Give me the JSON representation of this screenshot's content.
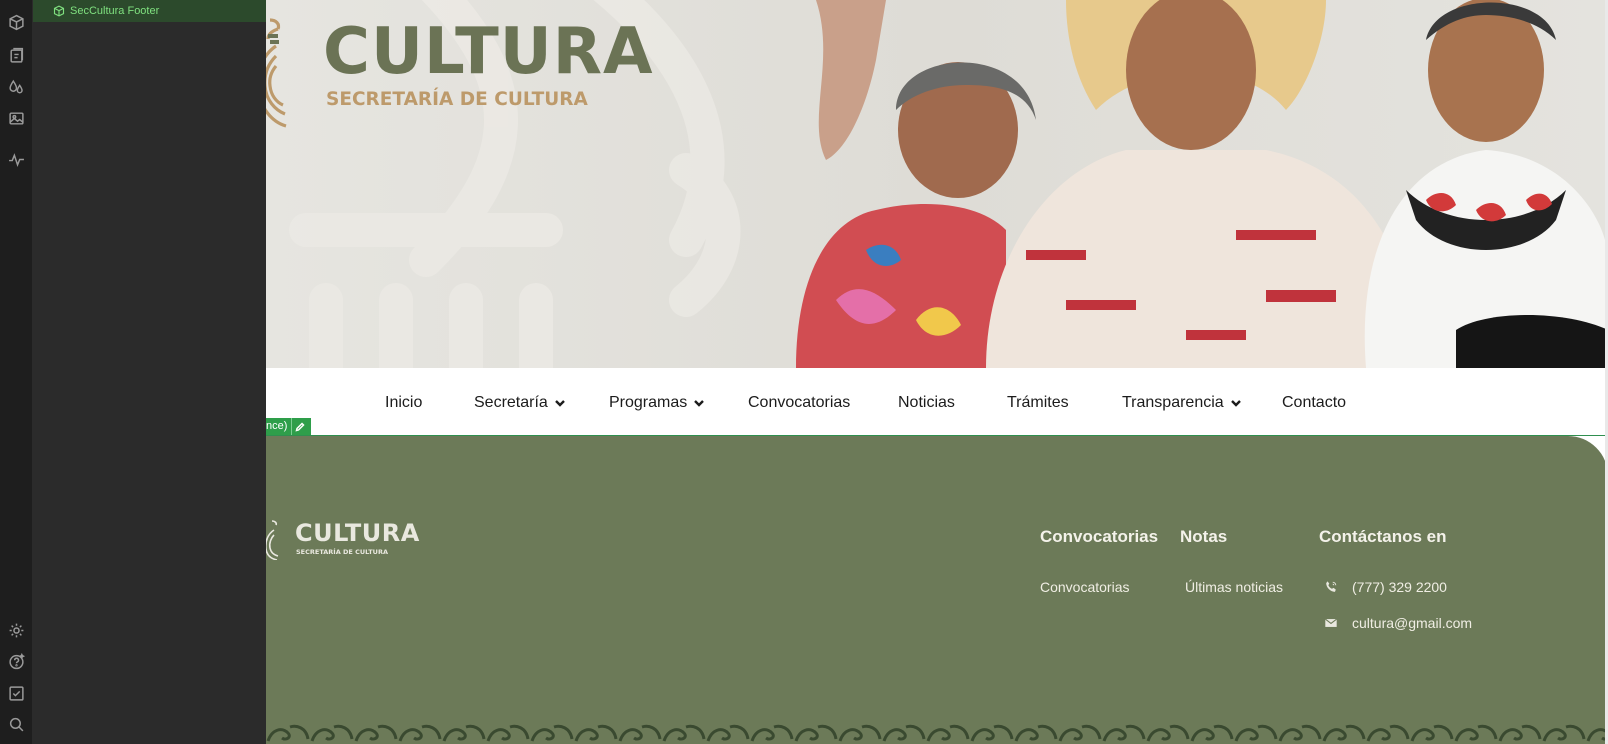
{
  "editor": {
    "rail_icons": [
      "cube-icon",
      "pages-icon",
      "droplets-icon",
      "image-icon",
      "activity-icon",
      "settings-icon",
      "help-icon",
      "checkbox-icon",
      "zoom-icon"
    ],
    "navigator": {
      "selected_item": "SecCultura Footer",
      "item_icon": "cube-outline-icon"
    },
    "selection_label": "nce)",
    "selection_action_icon": "pencil-icon",
    "selection_color": "#2e9e4a"
  },
  "site": {
    "brand": {
      "title": "CULTURA",
      "subtitle": "SECRETARÍA DE CULTURA",
      "title_color": "#6b7355",
      "subtitle_color": "#bd9a6b"
    },
    "menu": {
      "inicio": "Inicio",
      "secretaria": "Secretaría",
      "programas": "Programas",
      "convocatorias": "Convocatorias",
      "noticias": "Noticias",
      "tramites": "Trámites",
      "transparencia": "Transparencia",
      "contacto": "Contacto"
    },
    "footer": {
      "logo_title": "CULTURA",
      "logo_subtitle": "SECRETARÍA DE CULTURA",
      "bg_color": "#6c7a58",
      "col_convocatorias": {
        "heading": "Convocatorias",
        "link": "Convocatorias"
      },
      "col_notas": {
        "heading": "Notas",
        "link": "Últimas noticias"
      },
      "col_contacto": {
        "heading": "Contáctanos en",
        "phone": "(777) 329 2200",
        "email": "cultura@gmail.com"
      }
    }
  }
}
